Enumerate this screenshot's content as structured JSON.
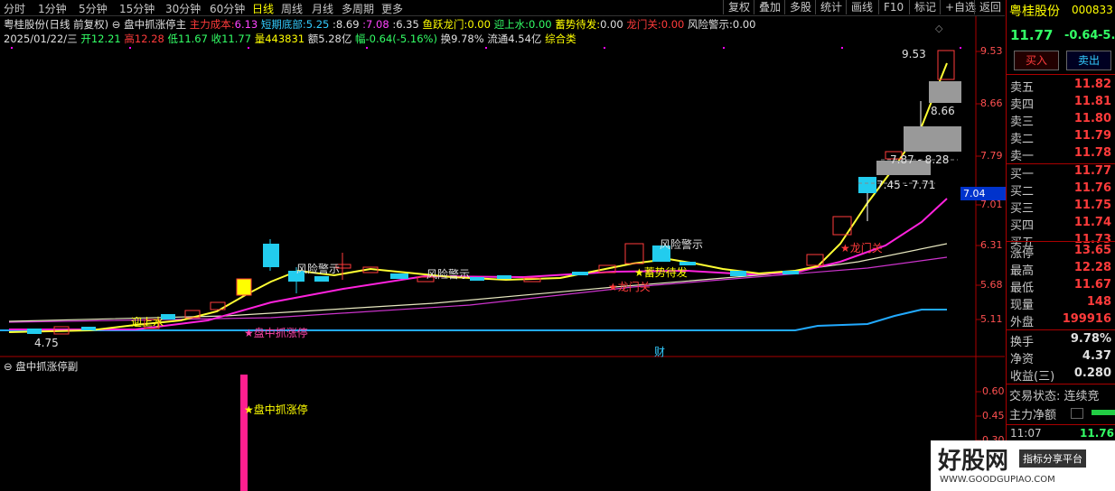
{
  "toolbar": {
    "left": [
      "分时",
      "1分钟",
      "5分钟",
      "15分钟",
      "30分钟",
      "60分钟",
      "日线",
      "周线",
      "月线",
      "多周期",
      "更多"
    ],
    "right": [
      "复权",
      "叠加",
      "多股",
      "统计",
      "画线",
      "F10",
      "标记",
      "+自选",
      "返回"
    ]
  },
  "main_header": {
    "stock": "粤桂股份(日线 前复权)",
    "formula": "盘中抓涨停主",
    "items": [
      {
        "label": "主力成本:",
        "value": "6.13"
      },
      {
        "label": "短期底部:",
        "value": "5.25"
      },
      {
        "label": ":",
        "value": "8.69"
      },
      {
        "label": ":",
        "value": "7.08"
      },
      {
        "label": ":",
        "value": "6.35"
      },
      {
        "label": "鱼跃龙门:",
        "value": "0.00"
      },
      {
        "label": "迎上水:",
        "value": "0.00"
      },
      {
        "label": "蓄势待发:",
        "value": "0.00"
      },
      {
        "label": "龙门关:",
        "value": "0.00"
      },
      {
        "label": "风险警示:",
        "value": "0.00"
      }
    ]
  },
  "quote_line": {
    "date": "2025/01/22/三",
    "open": "开12.21",
    "high": "高12.28",
    "low": "低11.67",
    "close": "收11.77",
    "volume": "量443831",
    "amount": "额5.28亿",
    "change": "幅-0.64(-5.16%)",
    "turnover": "换9.78%",
    "float": "流通4.54亿",
    "sector": "综合类"
  },
  "price_axis": [
    "9.53",
    "8.66",
    "7.79",
    "7.01",
    "6.31",
    "5.68",
    "5.11"
  ],
  "current_price_tag": "7.04",
  "sub_axis": [
    "0.60",
    "0.45",
    "0.30"
  ],
  "annotations": {
    "high_price": "9.53",
    "level_866": "8.66",
    "range_1": "7.87 - 8.28",
    "range_2": "7.45 - 7.71",
    "low_price": "4.75",
    "risk_1": "风险警示",
    "risk_2": "风险警示",
    "risk_3": "风险警示",
    "signal_zt": "盘中抓涨停",
    "signal_xs": "蓄势待发",
    "signal_lm": "龙门关",
    "signal_lm2": "龙门关",
    "signal_ysq": "迎上水",
    "cai": "财"
  },
  "sub_header": "盘中抓涨停副",
  "sub_signal": "盘中抓涨停",
  "panel": {
    "name": "粤桂股份",
    "code": "000833",
    "price": "11.77",
    "change": "-0.64",
    "pct": "-5.1",
    "buy": "买入",
    "sell": "卖出",
    "asks": [
      [
        "卖五",
        "11.82"
      ],
      [
        "卖四",
        "11.81"
      ],
      [
        "卖三",
        "11.80"
      ],
      [
        "卖二",
        "11.79"
      ],
      [
        "卖一",
        "11.78"
      ]
    ],
    "bids": [
      [
        "买一",
        "11.77"
      ],
      [
        "买二",
        "11.76"
      ],
      [
        "买三",
        "11.75"
      ],
      [
        "买四",
        "11.74"
      ],
      [
        "买五",
        "11.73"
      ]
    ],
    "stats": [
      [
        "涨停",
        "13.65"
      ],
      [
        "最高",
        "12.28"
      ],
      [
        "最低",
        "11.67"
      ],
      [
        "现量",
        "148"
      ],
      [
        "外盘",
        "199916"
      ]
    ],
    "stats2": [
      [
        "换手",
        "9.78%"
      ],
      [
        "净资",
        "4.37"
      ],
      [
        "收益(三)",
        "0.280"
      ]
    ],
    "state": "交易状态: 连续竞",
    "netflow": "主力净额",
    "tick_time": "11:07",
    "tick_price": "11.76"
  },
  "watermark": {
    "title": "好股网",
    "tag": "指标分享平台",
    "url": "WWW.GOODGUPIAO.COM"
  },
  "colors": {
    "up": "#ff3b3b",
    "down": "#33ccff",
    "ma_yellow": "#ffff33",
    "ma_magenta": "#ff22dd",
    "ma_white": "#e8e8c0",
    "ma_purple": "#cc33cc",
    "base_cyan": "#22aaff"
  }
}
